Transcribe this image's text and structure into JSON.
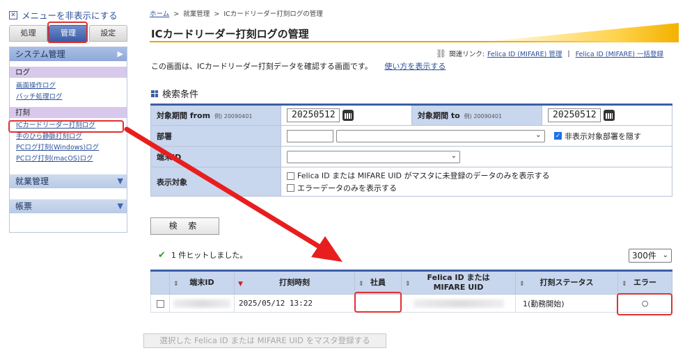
{
  "sidebar": {
    "menu_toggle": "メニューを非表示にする",
    "mode_tabs": [
      "処理",
      "管理",
      "設定"
    ],
    "system_header": "システム管理",
    "log_category": "ログ",
    "log_links": [
      "画面操作ログ",
      "バッチ処理ログ"
    ],
    "punch_category": "打刻",
    "punch_links": [
      "ICカードリーダー打刻ログ",
      "手のひら静脈打刻ログ",
      "PCログ打刻(Windows)ログ",
      "PCログ打刻(macOS)ログ"
    ],
    "work_header": "就業管理",
    "form_header": "帳票"
  },
  "breadcrumb": {
    "home": "ホーム",
    "sep": ">",
    "level1": "就業管理",
    "current": "ICカードリーダー打刻ログの管理"
  },
  "page": {
    "title": "ICカードリーダー打刻ログの管理",
    "related_label": "関連リンク:",
    "related_link1": "Felica ID (MIFARE) 管理",
    "related_sep": "|",
    "related_link2": "Felica ID (MIFARE) 一括登録",
    "description": "この画面は、ICカードリーダー打刻データを確認する画面です。",
    "howto_link": "使い方を表示する"
  },
  "search": {
    "section_title": "検索条件",
    "from_label": "対象期間 from",
    "from_example": "例) 20090401",
    "from_value": "20250512",
    "to_label": "対象期間 to",
    "to_example": "例) 20090401",
    "to_value": "20250512",
    "dept_label": "部署",
    "hide_dept_label": "非表示対象部署を隠す",
    "terminal_label": "端末ID",
    "display_label": "表示対象",
    "option_unregistered": "Felica ID または MIFARE UID がマスタに未登録のデータのみを表示する",
    "option_error": "エラーデータのみを表示する",
    "button": "検 索"
  },
  "results": {
    "hit_message": "1 件ヒットしました。",
    "page_size": "300件",
    "headers": [
      "端末ID",
      "打刻時刻",
      "社員",
      "Felica ID または\nMIFARE UID",
      "打刻ステータス",
      "エラー"
    ],
    "rows": [
      {
        "time": "2025/05/12 13:22",
        "status": "1(勤務開始)",
        "error": "○"
      }
    ],
    "register_button": "選択した Felica ID または MIFARE UID をマスタ登録する"
  },
  "colors": {
    "accent": "#3c5ea8",
    "highlight": "#e03030",
    "title_underline": "#e8a400"
  }
}
